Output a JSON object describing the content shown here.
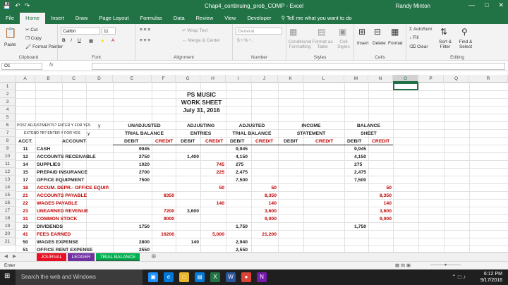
{
  "window": {
    "title": "Chap4_continuing_prob_COMP - Excel",
    "user": "Randy Minton",
    "qat": [
      "save-icon",
      "undo-icon",
      "redo-icon"
    ],
    "controls": {
      "minimize": "—",
      "maximize": "□",
      "close": "✕"
    }
  },
  "ribbon_tabs": [
    "File",
    "Home",
    "Insert",
    "Draw",
    "Page Layout",
    "Formulas",
    "Data",
    "Review",
    "View",
    "Developer"
  ],
  "active_tab": "Home",
  "tell_me": "Tell me what you want to do",
  "ribbon": {
    "clipboard": {
      "label": "Clipboard",
      "paste": "Paste",
      "cut": "Cut",
      "copy": "Copy",
      "format_painter": "Format Painter"
    },
    "font": {
      "label": "Font",
      "name": "Calibri",
      "size": "11",
      "bold": "B",
      "italic": "I",
      "underline": "U"
    },
    "alignment": {
      "label": "Alignment",
      "wrap": "Wrap Text",
      "merge": "Merge & Center"
    },
    "number": {
      "label": "Number",
      "format": "General"
    },
    "styles": {
      "label": "Styles",
      "conditional": "Conditional Formatting",
      "format_table": "Format as Table",
      "cell_styles": "Cell Styles"
    },
    "cells": {
      "label": "Cells",
      "insert": "Insert",
      "delete": "Delete",
      "format": "Format"
    },
    "editing": {
      "label": "Editing",
      "autosum": "AutoSum",
      "fill": "Fill",
      "clear": "Clear",
      "sort": "Sort & Filter",
      "find": "Find & Select"
    }
  },
  "formula_bar": {
    "name_box": "O1",
    "fx": "fx",
    "value": ""
  },
  "columns": [
    "A",
    "B",
    "C",
    "D",
    "E",
    "F",
    "G",
    "H",
    "I",
    "J",
    "K",
    "L",
    "M",
    "N",
    "O",
    "P",
    "Q",
    "R"
  ],
  "selected_column": "O",
  "row_numbers": [
    "1",
    "2",
    "3",
    "4",
    "5",
    "6",
    "7",
    "8",
    "9",
    "10",
    "11",
    "12",
    "13",
    "14",
    "15",
    "16",
    "17",
    "18",
    "19",
    "20",
    "21"
  ],
  "sheet": {
    "title": "PS MUSIC",
    "subtitle": "WORK SHEET",
    "date": "July 31, 2016",
    "post_adjustments": "POST ADJUSTMENTS? ENTER Y FOR YES",
    "post_adjustments_value": "y",
    "extend_tb": "EXTEND TB? ENTER Y FOR YES",
    "extend_tb_value": "y",
    "groups": [
      {
        "line1": "UNADJUSTED",
        "line2": "TRIAL BALANCE"
      },
      {
        "line1": "ADJUSTING",
        "line2": "ENTRIES"
      },
      {
        "line1": "ADJUSTED",
        "line2": "TRIAL BALANCE"
      },
      {
        "line1": "INCOME",
        "line2": "STATEMENT"
      },
      {
        "line1": "BALANCE",
        "line2": "SHEET"
      }
    ],
    "acct_header": "ACCT.",
    "account_header": "ACCOUNT",
    "debit": "DEBIT",
    "credit": "CREDIT",
    "rows": [
      {
        "acct": "11",
        "name": "CASH",
        "red": false,
        "e": "9945",
        "f": "",
        "g": "",
        "h": "",
        "i": "9,945",
        "j": "",
        "k": "",
        "l": "",
        "m": "9,945",
        "n": ""
      },
      {
        "acct": "12",
        "name": "ACCOUNTS RECEIVABLE",
        "red": false,
        "e": "2750",
        "f": "",
        "g": "1,400",
        "h": "",
        "i": "4,150",
        "j": "",
        "k": "",
        "l": "",
        "m": "4,150",
        "n": ""
      },
      {
        "acct": "14",
        "name": "SUPPLIES",
        "red": false,
        "e": "1020",
        "f": "",
        "g": "",
        "h": "745",
        "i": "275",
        "j": "",
        "k": "",
        "l": "",
        "m": "275",
        "n": ""
      },
      {
        "acct": "15",
        "name": "PREPAID INSURANCE",
        "red": false,
        "e": "2700",
        "f": "",
        "g": "",
        "h": "225",
        "i": "2,475",
        "j": "",
        "k": "",
        "l": "",
        "m": "2,475",
        "n": ""
      },
      {
        "acct": "17",
        "name": "OFFICE EQUIPMENT",
        "red": false,
        "e": "7500",
        "f": "",
        "g": "",
        "h": "",
        "i": "7,500",
        "j": "",
        "k": "",
        "l": "",
        "m": "7,500",
        "n": ""
      },
      {
        "acct": "18",
        "name": "ACCUM. DEPR.- OFFICE EQUIP.",
        "red": true,
        "e": "",
        "f": "",
        "g": "",
        "h": "50",
        "i": "",
        "j": "50",
        "k": "",
        "l": "",
        "m": "",
        "n": "50"
      },
      {
        "acct": "21",
        "name": "ACCOUNTS PAYABLE",
        "red": true,
        "e": "",
        "f": "8350",
        "g": "",
        "h": "",
        "i": "",
        "j": "8,350",
        "k": "",
        "l": "",
        "m": "",
        "n": "8,350"
      },
      {
        "acct": "22",
        "name": "WAGES PAYABLE",
        "red": true,
        "e": "",
        "f": "",
        "g": "",
        "h": "140",
        "i": "",
        "j": "140",
        "k": "",
        "l": "",
        "m": "",
        "n": "140"
      },
      {
        "acct": "23",
        "name": "UNEARNED REVENUE",
        "red": true,
        "e": "",
        "f": "7200",
        "g": "3,600",
        "h": "",
        "i": "",
        "j": "3,600",
        "k": "",
        "l": "",
        "m": "",
        "n": "3,600"
      },
      {
        "acct": "31",
        "name": "COMMON STOCK",
        "red": true,
        "e": "",
        "f": "9000",
        "g": "",
        "h": "",
        "i": "",
        "j": "9,000",
        "k": "",
        "l": "",
        "m": "",
        "n": "9,000"
      },
      {
        "acct": "33",
        "name": "DIVIDENDS",
        "red": false,
        "e": "1750",
        "f": "",
        "g": "",
        "h": "",
        "i": "1,750",
        "j": "",
        "k": "",
        "l": "",
        "m": "1,750",
        "n": ""
      },
      {
        "acct": "41",
        "name": "FEES EARNED",
        "red": true,
        "e": "",
        "f": "16200",
        "g": "",
        "h": "5,000",
        "i": "",
        "j": "21,200",
        "k": "",
        "l": "",
        "m": "",
        "n": ""
      },
      {
        "acct": "50",
        "name": "WAGES EXPENSE",
        "red": false,
        "e": "2800",
        "f": "",
        "g": "140",
        "h": "",
        "i": "2,940",
        "j": "",
        "k": "",
        "l": "",
        "m": "",
        "n": ""
      },
      {
        "acct": "51",
        "name": "OFFICE RENT EXPENSE",
        "red": false,
        "e": "2550",
        "f": "",
        "g": "",
        "h": "",
        "i": "2,550",
        "j": "",
        "k": "",
        "l": "",
        "m": "",
        "n": ""
      }
    ]
  },
  "sheet_tabs": [
    {
      "label": "JOURNAL",
      "color": "#e81123"
    },
    {
      "label": "LEDGER",
      "color": "#7030a0"
    },
    {
      "label": "TRIAL BALANCE",
      "color": "#00b050"
    }
  ],
  "active_sheet": "TRIAL BALANCE",
  "status": {
    "mode": "Enter"
  },
  "taskbar": {
    "search": "Search the web and Windows",
    "time": "6:12 PM",
    "date": "9/17/2016"
  }
}
